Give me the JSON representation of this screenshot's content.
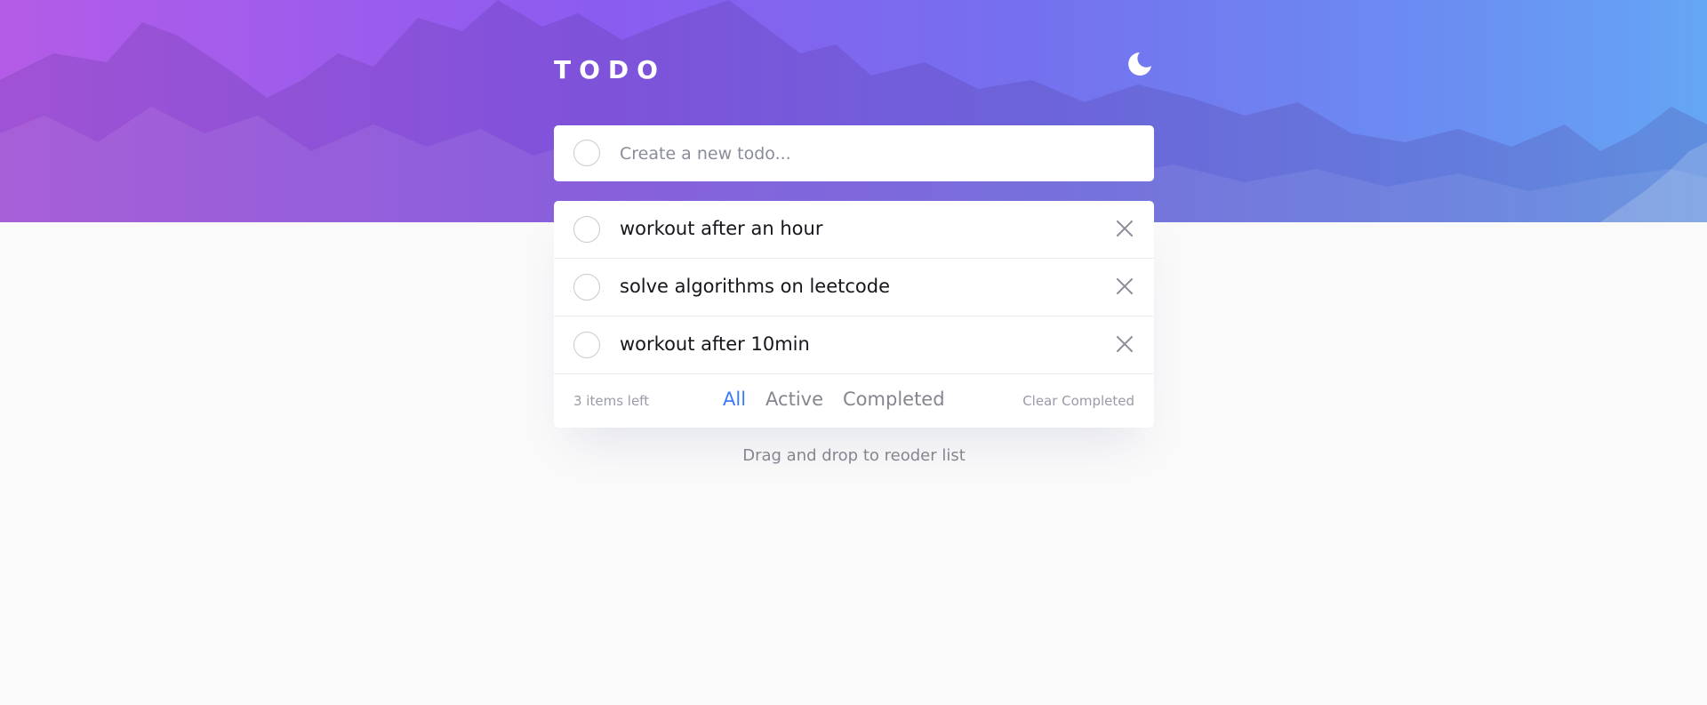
{
  "header": {
    "title": "TODO",
    "theme_icon": "moon-icon"
  },
  "new_todo": {
    "placeholder": "Create a new todo..."
  },
  "todos": [
    {
      "text": "workout after an hour",
      "completed": false
    },
    {
      "text": "solve algorithms on leetcode",
      "completed": false
    },
    {
      "text": "workout after 10min",
      "completed": false
    }
  ],
  "footer": {
    "items_left": "3 items left",
    "filters": [
      "All",
      "Active",
      "Completed"
    ],
    "active_filter": "All",
    "clear_completed": "Clear Completed"
  },
  "hint": "Drag and drop to reoder list",
  "colors": {
    "gradient_start": "#b45ce8",
    "gradient_end": "#65a6f4",
    "accent": "#3a7bfd",
    "page_background": "#fafafa"
  }
}
